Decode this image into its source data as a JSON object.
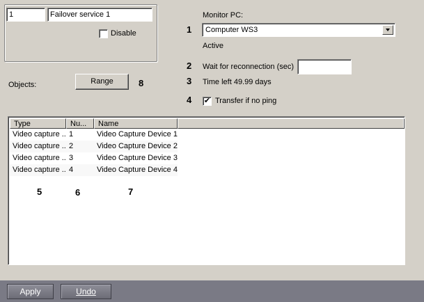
{
  "service": {
    "id_value": "1",
    "name_value": "Failover service 1",
    "disable_label": "Disable",
    "disable_checked": false
  },
  "objects": {
    "label": "Objects:",
    "range_button": "Range"
  },
  "monitor": {
    "label": "Monitor PC:",
    "selected": "Computer WS3",
    "status": "Active"
  },
  "reconnection": {
    "label": "Wait for reconnection (sec)",
    "value": ""
  },
  "time_left": "Time left 49.99 days",
  "transfer": {
    "label": "Transfer if no ping",
    "checked": true
  },
  "callouts": [
    "1",
    "2",
    "3",
    "4",
    "5",
    "6",
    "7",
    "8"
  ],
  "table": {
    "columns": [
      "Type",
      "Nu...",
      "Name"
    ],
    "rows": [
      [
        "Video capture ...",
        "1",
        "Video Capture Device 1"
      ],
      [
        "Video capture ...",
        "2",
        "Video Capture Device 2"
      ],
      [
        "Video capture ...",
        "3",
        "Video Capture Device 3"
      ],
      [
        "Video capture ...",
        "4",
        "Video Capture Device 4"
      ]
    ]
  },
  "footer": {
    "apply": "Apply",
    "undo": "Undo"
  }
}
